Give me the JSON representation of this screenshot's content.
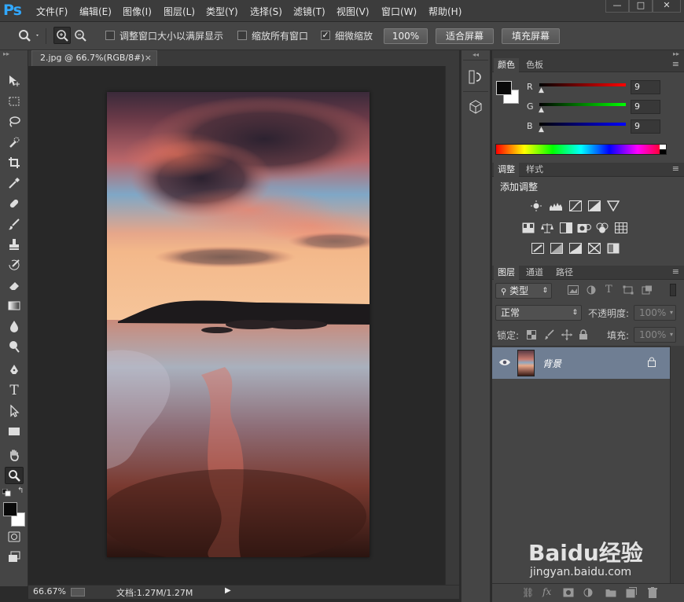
{
  "app": {
    "logo": "Ps"
  },
  "menu": [
    "文件(F)",
    "编辑(E)",
    "图像(I)",
    "图层(L)",
    "类型(Y)",
    "选择(S)",
    "滤镜(T)",
    "视图(V)",
    "窗口(W)",
    "帮助(H)"
  ],
  "window_controls": {
    "minimize": "—",
    "restore": "□",
    "close": "✕"
  },
  "options": {
    "resize_windows": "调整窗口大小以满屏显示",
    "zoom_all": "缩放所有窗口",
    "scrubby_zoom": "细微缩放",
    "scrubby_checked": true,
    "btn_100": "100%",
    "btn_fit": "适合屏幕",
    "btn_fill": "填充屏幕"
  },
  "document": {
    "tab_title": "2.jpg @ 66.7%(RGB/8#)",
    "tab_close": "×",
    "zoom": "66.67%",
    "doc_info": "文档:1.27M/1.27M"
  },
  "color_panel": {
    "tabs": [
      "颜色",
      "色板"
    ],
    "channels": [
      {
        "label": "R",
        "value": "9",
        "color": "#e02020"
      },
      {
        "label": "G",
        "value": "9",
        "color": "#20c020"
      },
      {
        "label": "B",
        "value": "9",
        "color": "#2030e0"
      }
    ]
  },
  "adjust_panel": {
    "tabs": [
      "调整",
      "样式"
    ],
    "heading": "添加调整"
  },
  "layers_panel": {
    "tabs": [
      "图层",
      "通道",
      "路径"
    ],
    "filter_kind": "类型",
    "blend_mode": "正常",
    "opacity_label": "不透明度:",
    "opacity_value": "100%",
    "lock_label": "锁定:",
    "fill_label": "填充:",
    "fill_value": "100%",
    "layers": [
      {
        "name": "背景",
        "visible": true,
        "locked": true
      }
    ]
  },
  "watermark": {
    "brand": "Baidu经验",
    "url": "jingyan.baidu.com"
  }
}
